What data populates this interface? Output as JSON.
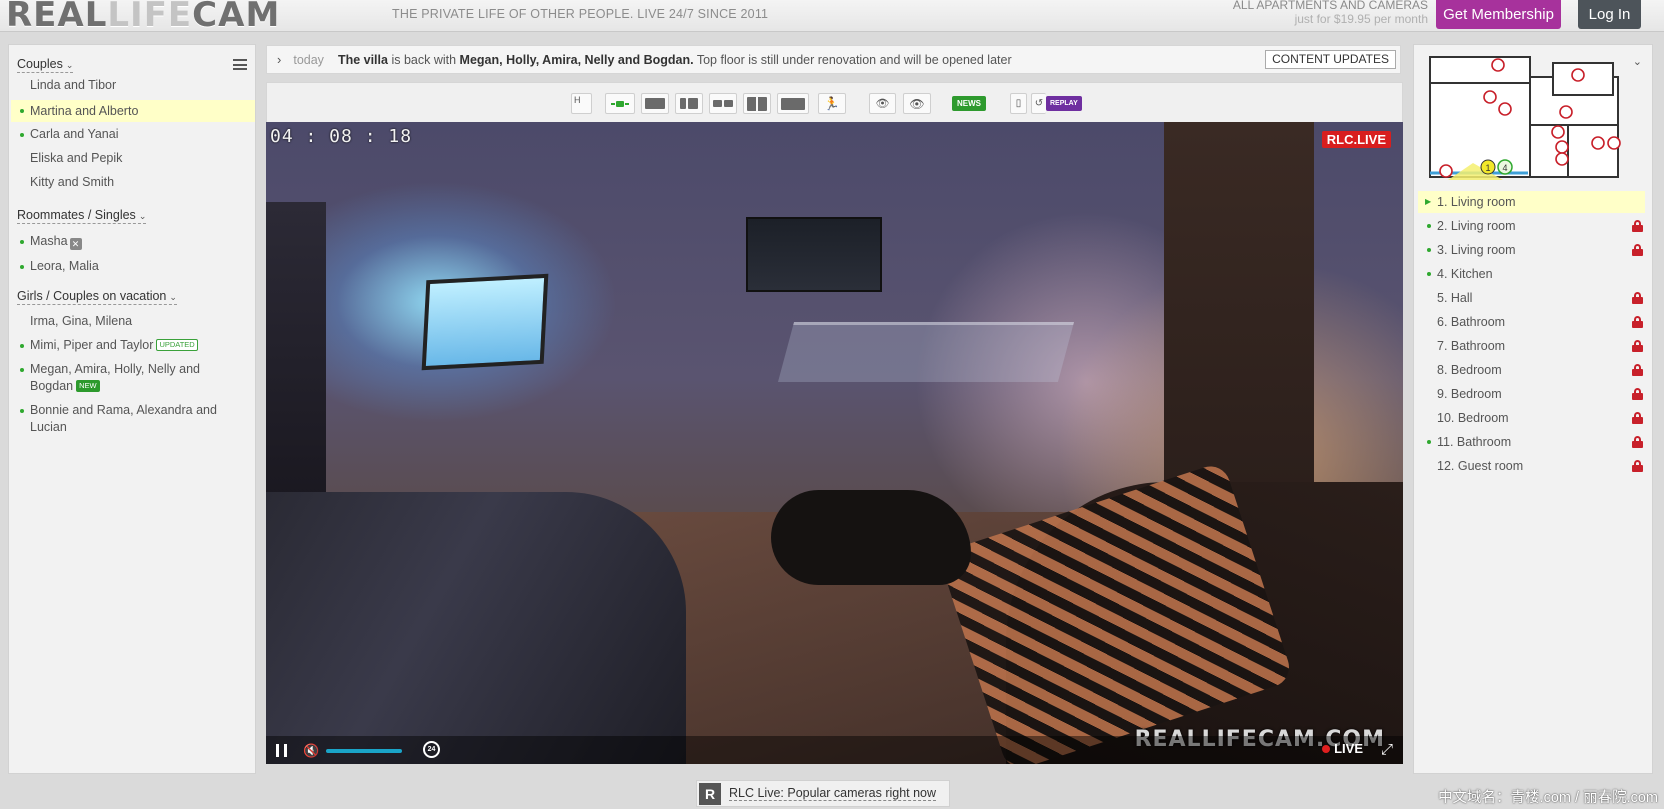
{
  "header": {
    "logo": {
      "part1": "REAL",
      "part2": "LIFE",
      "part3": "CAM"
    },
    "tagline": "THE PRIVATE LIFE OF OTHER PEOPLE. LIVE 24/7 SINCE 2011",
    "promo_line1": "ALL APARTMENTS AND CAMERAS",
    "promo_line2": "just for $19.95 per month",
    "membership_label": "Get Membership",
    "login_label": "Log In"
  },
  "sidebar": {
    "groups": [
      {
        "title": "Couples",
        "items": [
          {
            "label": "Linda and Tibor",
            "online": false
          },
          {
            "label": "Martina and Alberto",
            "online": true,
            "active": true
          },
          {
            "label": "Carla and Yanai",
            "online": true
          },
          {
            "label": "Eliska and Pepik",
            "online": false
          },
          {
            "label": "Kitty and Smith",
            "online": false
          }
        ]
      },
      {
        "title": "Roommates / Singles",
        "items": [
          {
            "label": "Masha",
            "online": true
          },
          {
            "label": "Leora, Malia",
            "online": true
          }
        ]
      },
      {
        "title": "Girls / Couples on vacation",
        "items": [
          {
            "label": "Irma, Gina, Milena",
            "online": false
          },
          {
            "label": "Mimi, Piper and Taylor",
            "online": true,
            "badge": "UPDATED"
          },
          {
            "label_line1": "Megan, Amira, Holly, Nelly and",
            "label_line2": "Bogdan",
            "online": true,
            "badge": "NEW"
          },
          {
            "label_line1": "Bonnie and Rama, Alexandra and",
            "label_line2": "Lucian",
            "online": true
          }
        ]
      }
    ]
  },
  "newsbar": {
    "when": "today",
    "bold1": "The villa",
    "text1": " is back with ",
    "bold2": "Megan, Holly, Amira, Nelly and Bogdan.",
    "text2": " Top floor is still under renovation and will be opened later",
    "content_updates_label": "CONTENT UPDATES"
  },
  "toolbar": {
    "hd_label": "H",
    "news_label": "NEWS",
    "replay_label": "REPLAY"
  },
  "player": {
    "timestamp": "04 : 08 : 18",
    "badge": "RLC.LIVE",
    "watermark": "REALLIFECAM.COM",
    "live_label": "LIVE",
    "rewind_label": "24",
    "volume_level": 1.0
  },
  "floorplan": {
    "camera_markers": [
      "1",
      "4"
    ]
  },
  "cameras": [
    {
      "label": "1. Living room",
      "online": true,
      "locked": false,
      "active": true
    },
    {
      "label": "2. Living room",
      "online": true,
      "locked": true
    },
    {
      "label": "3. Living room",
      "online": true,
      "locked": true
    },
    {
      "label": "4. Kitchen",
      "online": true,
      "locked": false
    },
    {
      "label": "5. Hall",
      "online": false,
      "locked": true
    },
    {
      "label": "6. Bathroom",
      "online": false,
      "locked": true
    },
    {
      "label": "7. Bathroom",
      "online": false,
      "locked": true
    },
    {
      "label": "8. Bedroom",
      "online": false,
      "locked": true
    },
    {
      "label": "9. Bedroom",
      "online": false,
      "locked": true
    },
    {
      "label": "10. Bedroom",
      "online": false,
      "locked": true
    },
    {
      "label": "11. Bathroom",
      "online": true,
      "locked": true
    },
    {
      "label": "12. Guest room",
      "online": false,
      "locked": true
    }
  ],
  "bottom": {
    "popular_label": "RLC Live: Popular cameras right now",
    "icon_letter": "R"
  },
  "overlay": {
    "cn_watermark": "中文域名：青楼.com / 丽春院.com"
  },
  "colors": {
    "accent_membership": "#a7329c",
    "login_bg": "#4d545a",
    "online_dot": "#2fa82f",
    "active_row": "#ffffc8",
    "lock": "#c8202a",
    "live_badge": "#d81e1e"
  }
}
